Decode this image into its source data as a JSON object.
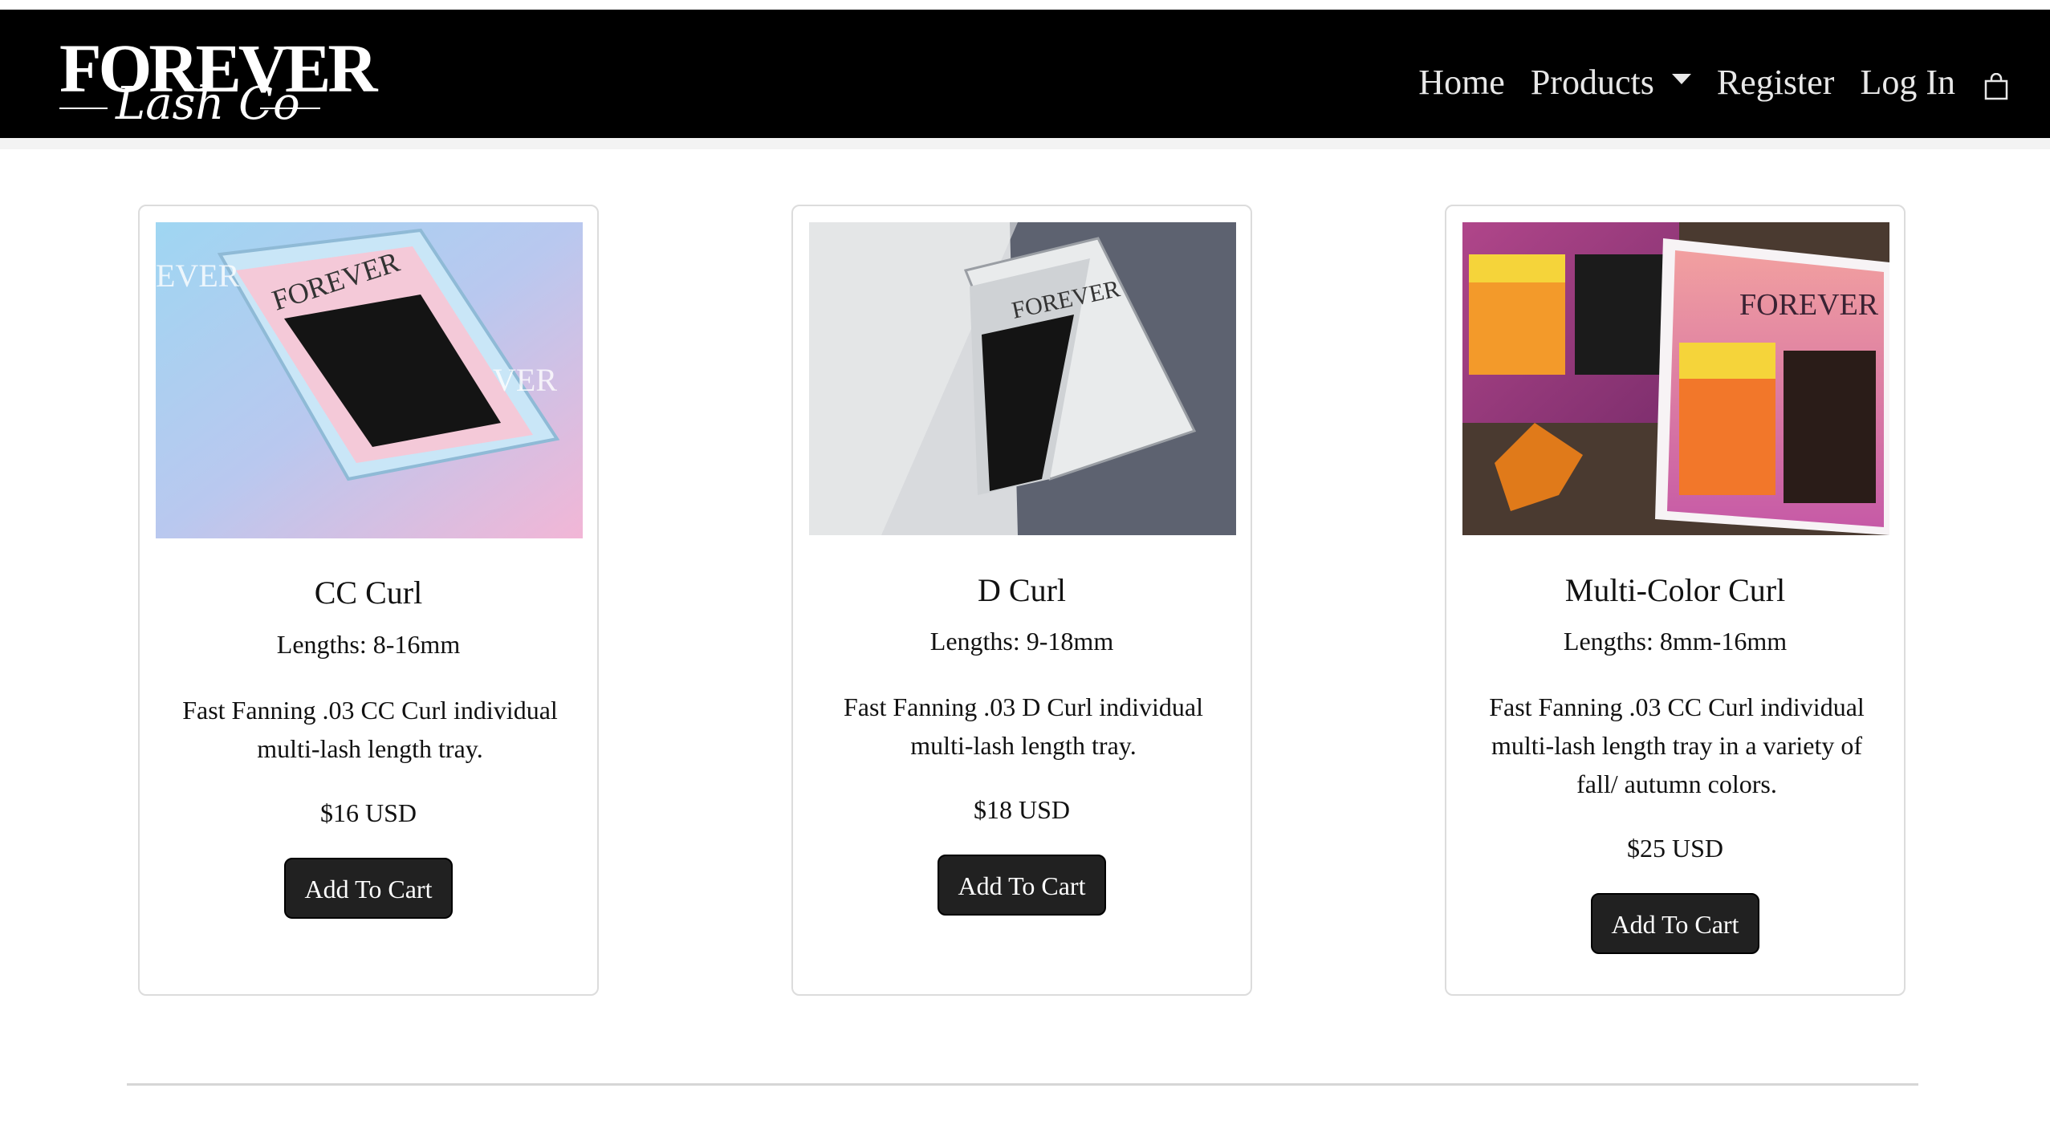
{
  "brand": {
    "logo_top": "FOREVER",
    "logo_script": "Lash Co"
  },
  "nav": {
    "home": "Home",
    "products": "Products",
    "register": "Register",
    "login": "Log In",
    "cart_icon": "shopping-bag-icon"
  },
  "products": [
    {
      "title": "CC Curl",
      "lengths": "Lengths: 8-16mm",
      "desc_line1": "Fast Fanning .03 CC Curl individual",
      "desc_line2": "multi-lash length tray.",
      "desc_line3": "",
      "price": "$16 USD",
      "button": "Add To Cart",
      "image_text": "FOREVER"
    },
    {
      "title": "D Curl",
      "lengths": "Lengths: 9-18mm",
      "desc_line1": "Fast Fanning .03 D Curl individual",
      "desc_line2": "multi-lash length tray.",
      "desc_line3": "",
      "price": "$18 USD",
      "button": "Add To Cart",
      "image_text": "FOREVER"
    },
    {
      "title": "Multi-Color Curl",
      "lengths": "Lengths: 8mm-16mm",
      "desc_line1": "Fast Fanning .03 CC Curl individual",
      "desc_line2": "multi-lash length tray in a variety of",
      "desc_line3": "fall/ autumn colors.",
      "price": "$25 USD",
      "button": "Add To Cart",
      "image_text": "FOREVER"
    }
  ],
  "colors": {
    "navbar_bg": "#000000",
    "button_bg": "#212121",
    "card_border": "#dcdcdc"
  }
}
